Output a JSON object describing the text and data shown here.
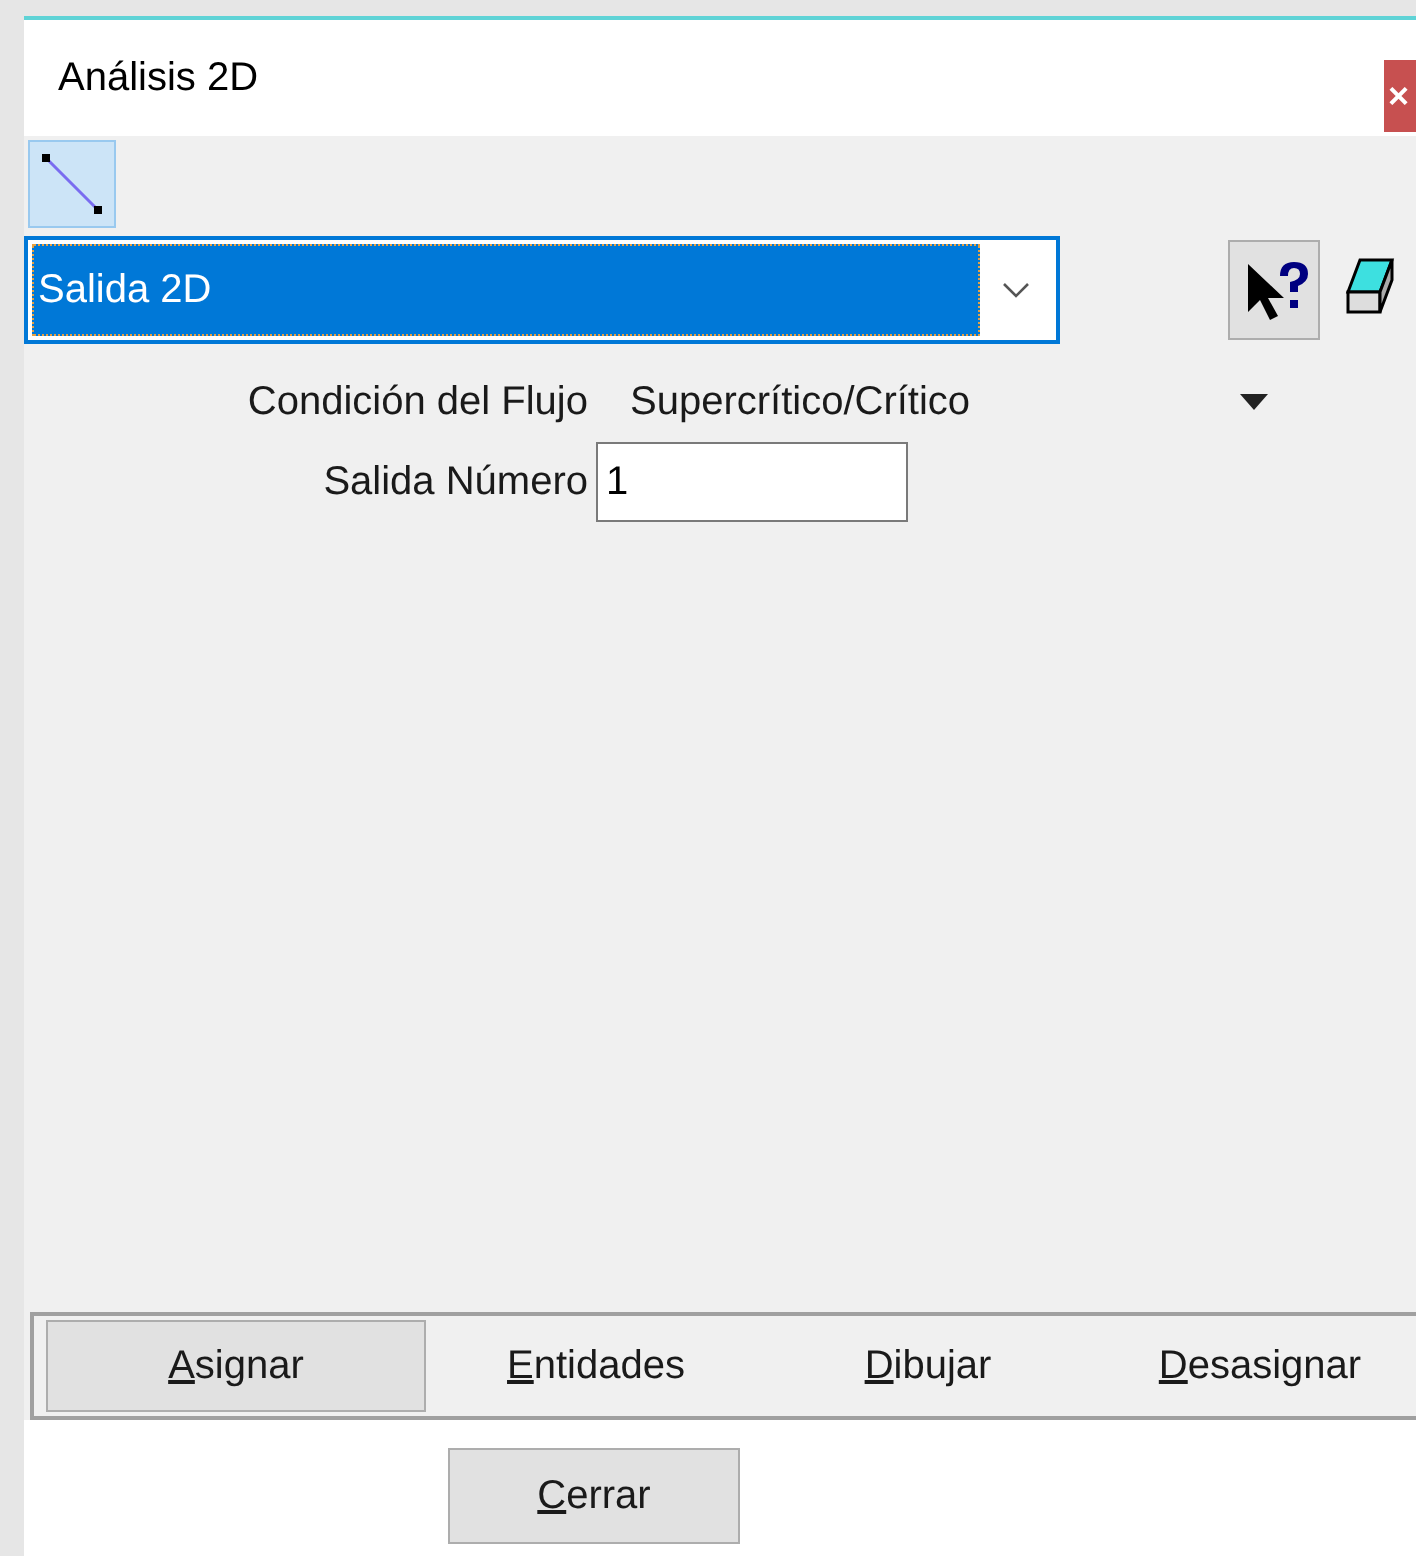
{
  "window": {
    "title": "Análisis 2D",
    "close": "×"
  },
  "toolbar": [
    {
      "kind": "line",
      "selected": true
    }
  ],
  "selector": {
    "value": "Salida 2D"
  },
  "fields": [
    {
      "kind": "dropdown",
      "label": "Condición del Flujo",
      "value": "Supercrítico/Crítico"
    },
    {
      "kind": "input",
      "label": "Salida Número",
      "value": "1"
    }
  ],
  "actions": [
    {
      "label": "Asignar",
      "selected": true
    },
    {
      "label": "Entidades",
      "selected": false
    },
    {
      "label": "Dibujar",
      "selected": false
    },
    {
      "label": "Desasignar",
      "selected": false
    }
  ],
  "close_button": {
    "label": "Cerrar"
  }
}
